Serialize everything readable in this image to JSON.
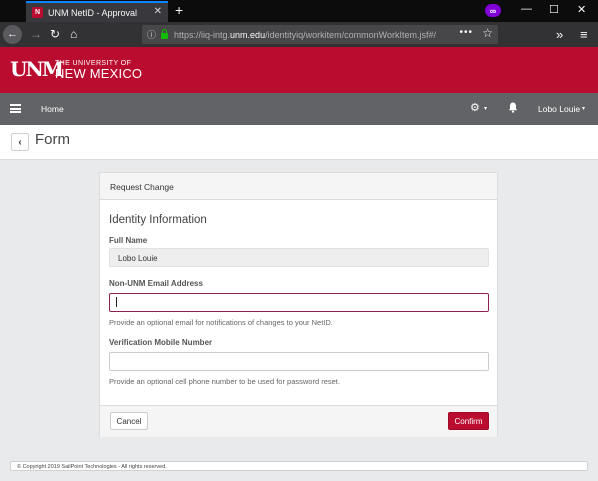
{
  "browser": {
    "tab_title": "UNM NetID - Approval",
    "tab_favicon": "N",
    "url_prefix": "https://iiq-intg.",
    "url_domain": "unm.edu",
    "url_path": "/identityiq/workitem/commonWorkItem.jsf#/",
    "more_label": "•••",
    "new_tab_icon": "+",
    "close_icon": "✕",
    "minimize_icon": "—",
    "maximize_icon": "☐",
    "window_close_icon": "✕",
    "private_icon": "∞",
    "overflow_icon": "»",
    "menu_icon": "≡",
    "accent_color": "#0a84ff"
  },
  "brand": {
    "logo_mark": "UNM",
    "logo_small": "THE UNIVERSITY OF",
    "logo_big": "NEW MEXICO",
    "color": "#ba0c2f"
  },
  "appbar": {
    "home_label": "Home",
    "user_name": "Lobo Louie",
    "caret": "▾"
  },
  "page": {
    "title": "Form",
    "back_icon": "‹"
  },
  "form": {
    "card_title": "Request Change",
    "section_title": "Identity Information",
    "full_name_label": "Full Name",
    "full_name_value": "Lobo Louie",
    "email_label": "Non-UNM Email Address",
    "email_value": "",
    "email_help": "Provide an optional email for notifications of changes to your NetID.",
    "mobile_label": "Verification Mobile Number",
    "mobile_value": "",
    "mobile_help": "Provide an optional cell phone number to be used for password reset.",
    "cancel_label": "Cancel",
    "confirm_label": "Confirm"
  },
  "footer": {
    "copyright": "© Copyright 2019 SailPoint Technologies - All rights reserved."
  }
}
